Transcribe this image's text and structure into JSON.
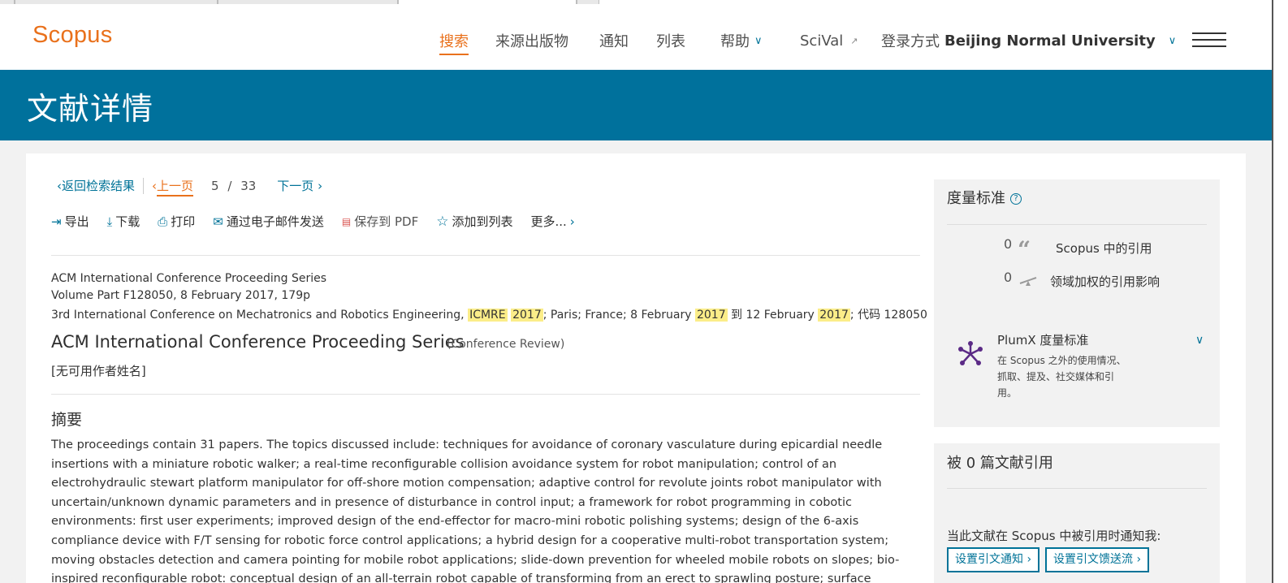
{
  "header": {
    "logo": "Scopus",
    "nav": {
      "search": "搜索",
      "sources": "来源出版物",
      "alerts": "通知",
      "lists": "列表",
      "help": "帮助",
      "scival": "SciVal",
      "login_prefix": "登录方式",
      "institution": "Beijing Normal University"
    }
  },
  "page_title": "文献详情",
  "breadcrumb": {
    "back": "返回检索结果",
    "prev": "上一页",
    "position": "5",
    "separator": "/",
    "total": "33",
    "next": "下一页"
  },
  "toolbar": {
    "export": "导出",
    "download": "下载",
    "print": "打印",
    "email": "通过电子邮件发送",
    "save_pdf": "保存到 PDF",
    "add_to_list": "添加到列表",
    "more": "更多..."
  },
  "source": {
    "series": "ACM International Conference Proceeding Series",
    "volume": "Volume Part F128050, 8 February 2017, 179p",
    "conf_pre": "3rd International Conference on Mechatronics and Robotics Engineering, ",
    "conf_hl1": "ICMRE",
    "conf_hl2": "2017",
    "conf_mid1": "; Paris; France; 8 February ",
    "conf_hl3": "2017",
    "conf_mid2": " 到 12 February ",
    "conf_hl4": "2017",
    "conf_post": "; 代码 128050"
  },
  "document": {
    "title": "ACM International Conference Proceeding Series",
    "type": "(Conference Review)",
    "authors": "[无可用作者姓名]"
  },
  "abstract": {
    "heading": "摘要",
    "text": "The proceedings contain 31 papers. The topics discussed include: techniques for avoidance of coronary vasculature during epicardial needle insertions with a miniature robotic walker; a real-time reconfigurable collision avoidance system for robot manipulation; control of an electrohydraulic stewart platform manipulator for off-shore motion compensation; adaptive control for revolute joints robot manipulator with uncertain/unknown dynamic parameters and in presence of disturbance in control input; a framework for robot programming in cobotic environments: first user experiments; improved design of the end-effector for macro-mini robotic polishing systems; design of the 6-axis compliance device with F/T sensing for robotic force control applications; a hybrid design for a cooperative multi-robot transportation system; moving obstacles detection and camera pointing for mobile robot applications; slide-down prevention for wheeled mobile robots on slopes; bio-inspired reconfigurable robot: conceptual design of an all-terrain robot capable of transforming from an erect to sprawling posture; surface finishing:"
  },
  "metrics": {
    "heading": "度量标准",
    "citations_count": "0",
    "citations_label": "Scopus 中的引用",
    "fwci_count": "0",
    "fwci_label": "领域加权的引用影响",
    "plumx_title": "PlumX 度量标准",
    "plumx_desc": "在 Scopus 之外的使用情况、抓取、提及、社交媒体和引用。"
  },
  "cited_by": {
    "heading": "被 0 篇文献引用",
    "notify_text": "当此文献在 Scopus 中被引用时通知我:",
    "alert_button": "设置引文通知 ›",
    "feed_button": "设置引文馈送流 ›"
  }
}
